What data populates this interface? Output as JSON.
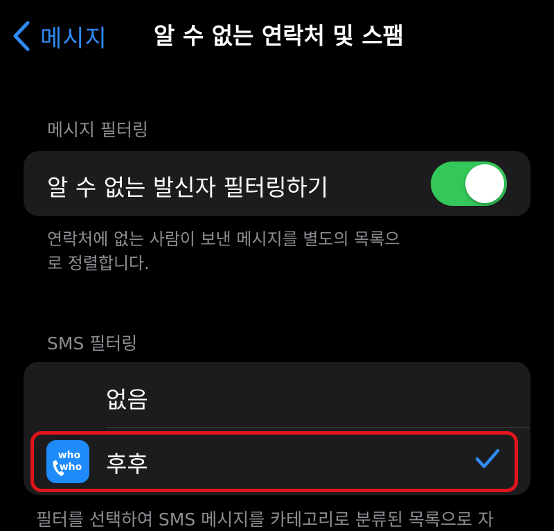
{
  "nav": {
    "back_label": "메시지",
    "title": "알 수 없는 연락처 및 스팸"
  },
  "message_filtering": {
    "header": "메시지 필터링",
    "toggle_label": "알 수 없는 발신자 필터링하기",
    "toggle_on": true,
    "footer": "연락처에 없는 사람이 보낸 메시지를 별도의 목록으로 정렬합니다."
  },
  "sms_filtering": {
    "header": "SMS 필터링",
    "options": [
      {
        "label": "없음",
        "selected": false
      },
      {
        "label": "후후",
        "selected": true,
        "icon": "whowho-app-icon"
      }
    ],
    "footer": "필터를 선택하여 SMS 메시지를 카테고리로 분류된 목록으로 자"
  },
  "colors": {
    "accent": "#2f8bf5",
    "toggle_on": "#34c759",
    "group_bg": "#1c1c1e",
    "secondary_text": "#8d8d93",
    "highlight": "#e0141b"
  }
}
